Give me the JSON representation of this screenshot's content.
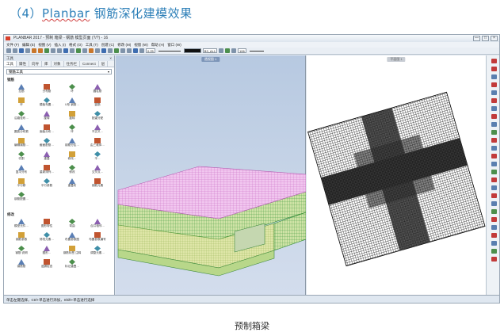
{
  "heading": {
    "prefix": "（4）",
    "brand": "Planbar",
    "rest": " 钢筋深化建模效果"
  },
  "window": {
    "title": "PLANBAR 2017 - 预制 箱梁 - 钢筋 模型页面 (?/?) - 16",
    "buttons": [
      "—",
      "□",
      "×"
    ]
  },
  "menu": [
    "文件 (F)",
    "编辑 (E)",
    "视图 (V)",
    "插入 (I)",
    "格式 (O)",
    "工具 (T)",
    "创建 (C)",
    "修改 (M)",
    "视窗 (W)",
    "帮助 (H)",
    "窗口 (W)"
  ],
  "toolbar": {
    "scale_value": "0.25",
    "layer_value": "B3_AL1",
    "count_value": "106"
  },
  "panel": {
    "title": "工具",
    "close": "×",
    "tabs": [
      "工具",
      "属性",
      "向导",
      "库",
      "对象",
      "任务栏",
      "Connect",
      "层"
    ],
    "active_tab": "工具",
    "selector": "钢筋工具",
    "selector_chevron": "▾",
    "group1_label": "钢筋",
    "tools1": [
      {
        "label": "拉筋"
      },
      {
        "label": "分布筋"
      },
      {
        "label": "环"
      },
      {
        "label": "圆柱筋"
      },
      {
        "label": "环"
      },
      {
        "label": "模板布置…"
      },
      {
        "label": "U形 钢筋…"
      },
      {
        "label": "篮筋"
      },
      {
        "label": "沿路径布…"
      },
      {
        "label": "旋转"
      },
      {
        "label": "旋转"
      },
      {
        "label": "配重分配"
      },
      {
        "label": "圆弧分布筋"
      },
      {
        "label": "面板分布…"
      },
      {
        "label": "环"
      },
      {
        "label": "不交叉…"
      },
      {
        "label": "编辑钢筋…"
      },
      {
        "label": "截面配筋…"
      },
      {
        "label": "钢筋分区…"
      },
      {
        "label": "由三维体…"
      },
      {
        "label": "切割"
      },
      {
        "label": "重叠"
      },
      {
        "label": "修改…"
      },
      {
        "label": "平…"
      },
      {
        "label": "复平分布"
      },
      {
        "label": "重新排列…"
      },
      {
        "label": "修改"
      },
      {
        "label": "交叉点…"
      },
      {
        "label": "平行移"
      },
      {
        "label": "平行参数"
      },
      {
        "label": "重叠布"
      },
      {
        "label": "钢筋元素"
      },
      {
        "label": "钢筋配置…"
      }
    ],
    "group2_label": "修改",
    "tools2": [
      {
        "label": "模型元件…"
      },
      {
        "label": "图形特性"
      },
      {
        "label": "弯曲"
      },
      {
        "label": "合并相邻…"
      },
      {
        "label": "钢筋参数"
      },
      {
        "label": "修改元素…"
      },
      {
        "label": "布置参数图"
      },
      {
        "label": "布置参数编号"
      },
      {
        "label": "钢筋 说明"
      },
      {
        "label": "图形…"
      },
      {
        "label": "钢筋标签 注释"
      },
      {
        "label": "调整元素…"
      },
      {
        "label": "钢筋筋"
      },
      {
        "label": "遗漏检查"
      },
      {
        "label": "标记重叠…"
      }
    ]
  },
  "status": "单击左键选择，Ctrl+单击进行添加，Shift+单击进行选择",
  "viewports": {
    "left_tag": "透视图 1",
    "right_tag": "平面图 1"
  },
  "colors": {
    "accent": "#2c7fb8",
    "view3d_bg": "#c3d2e6",
    "rebar_pink": "#e9a7e6",
    "rebar_green": "#4aa04a"
  },
  "caption": "预制箱梁"
}
